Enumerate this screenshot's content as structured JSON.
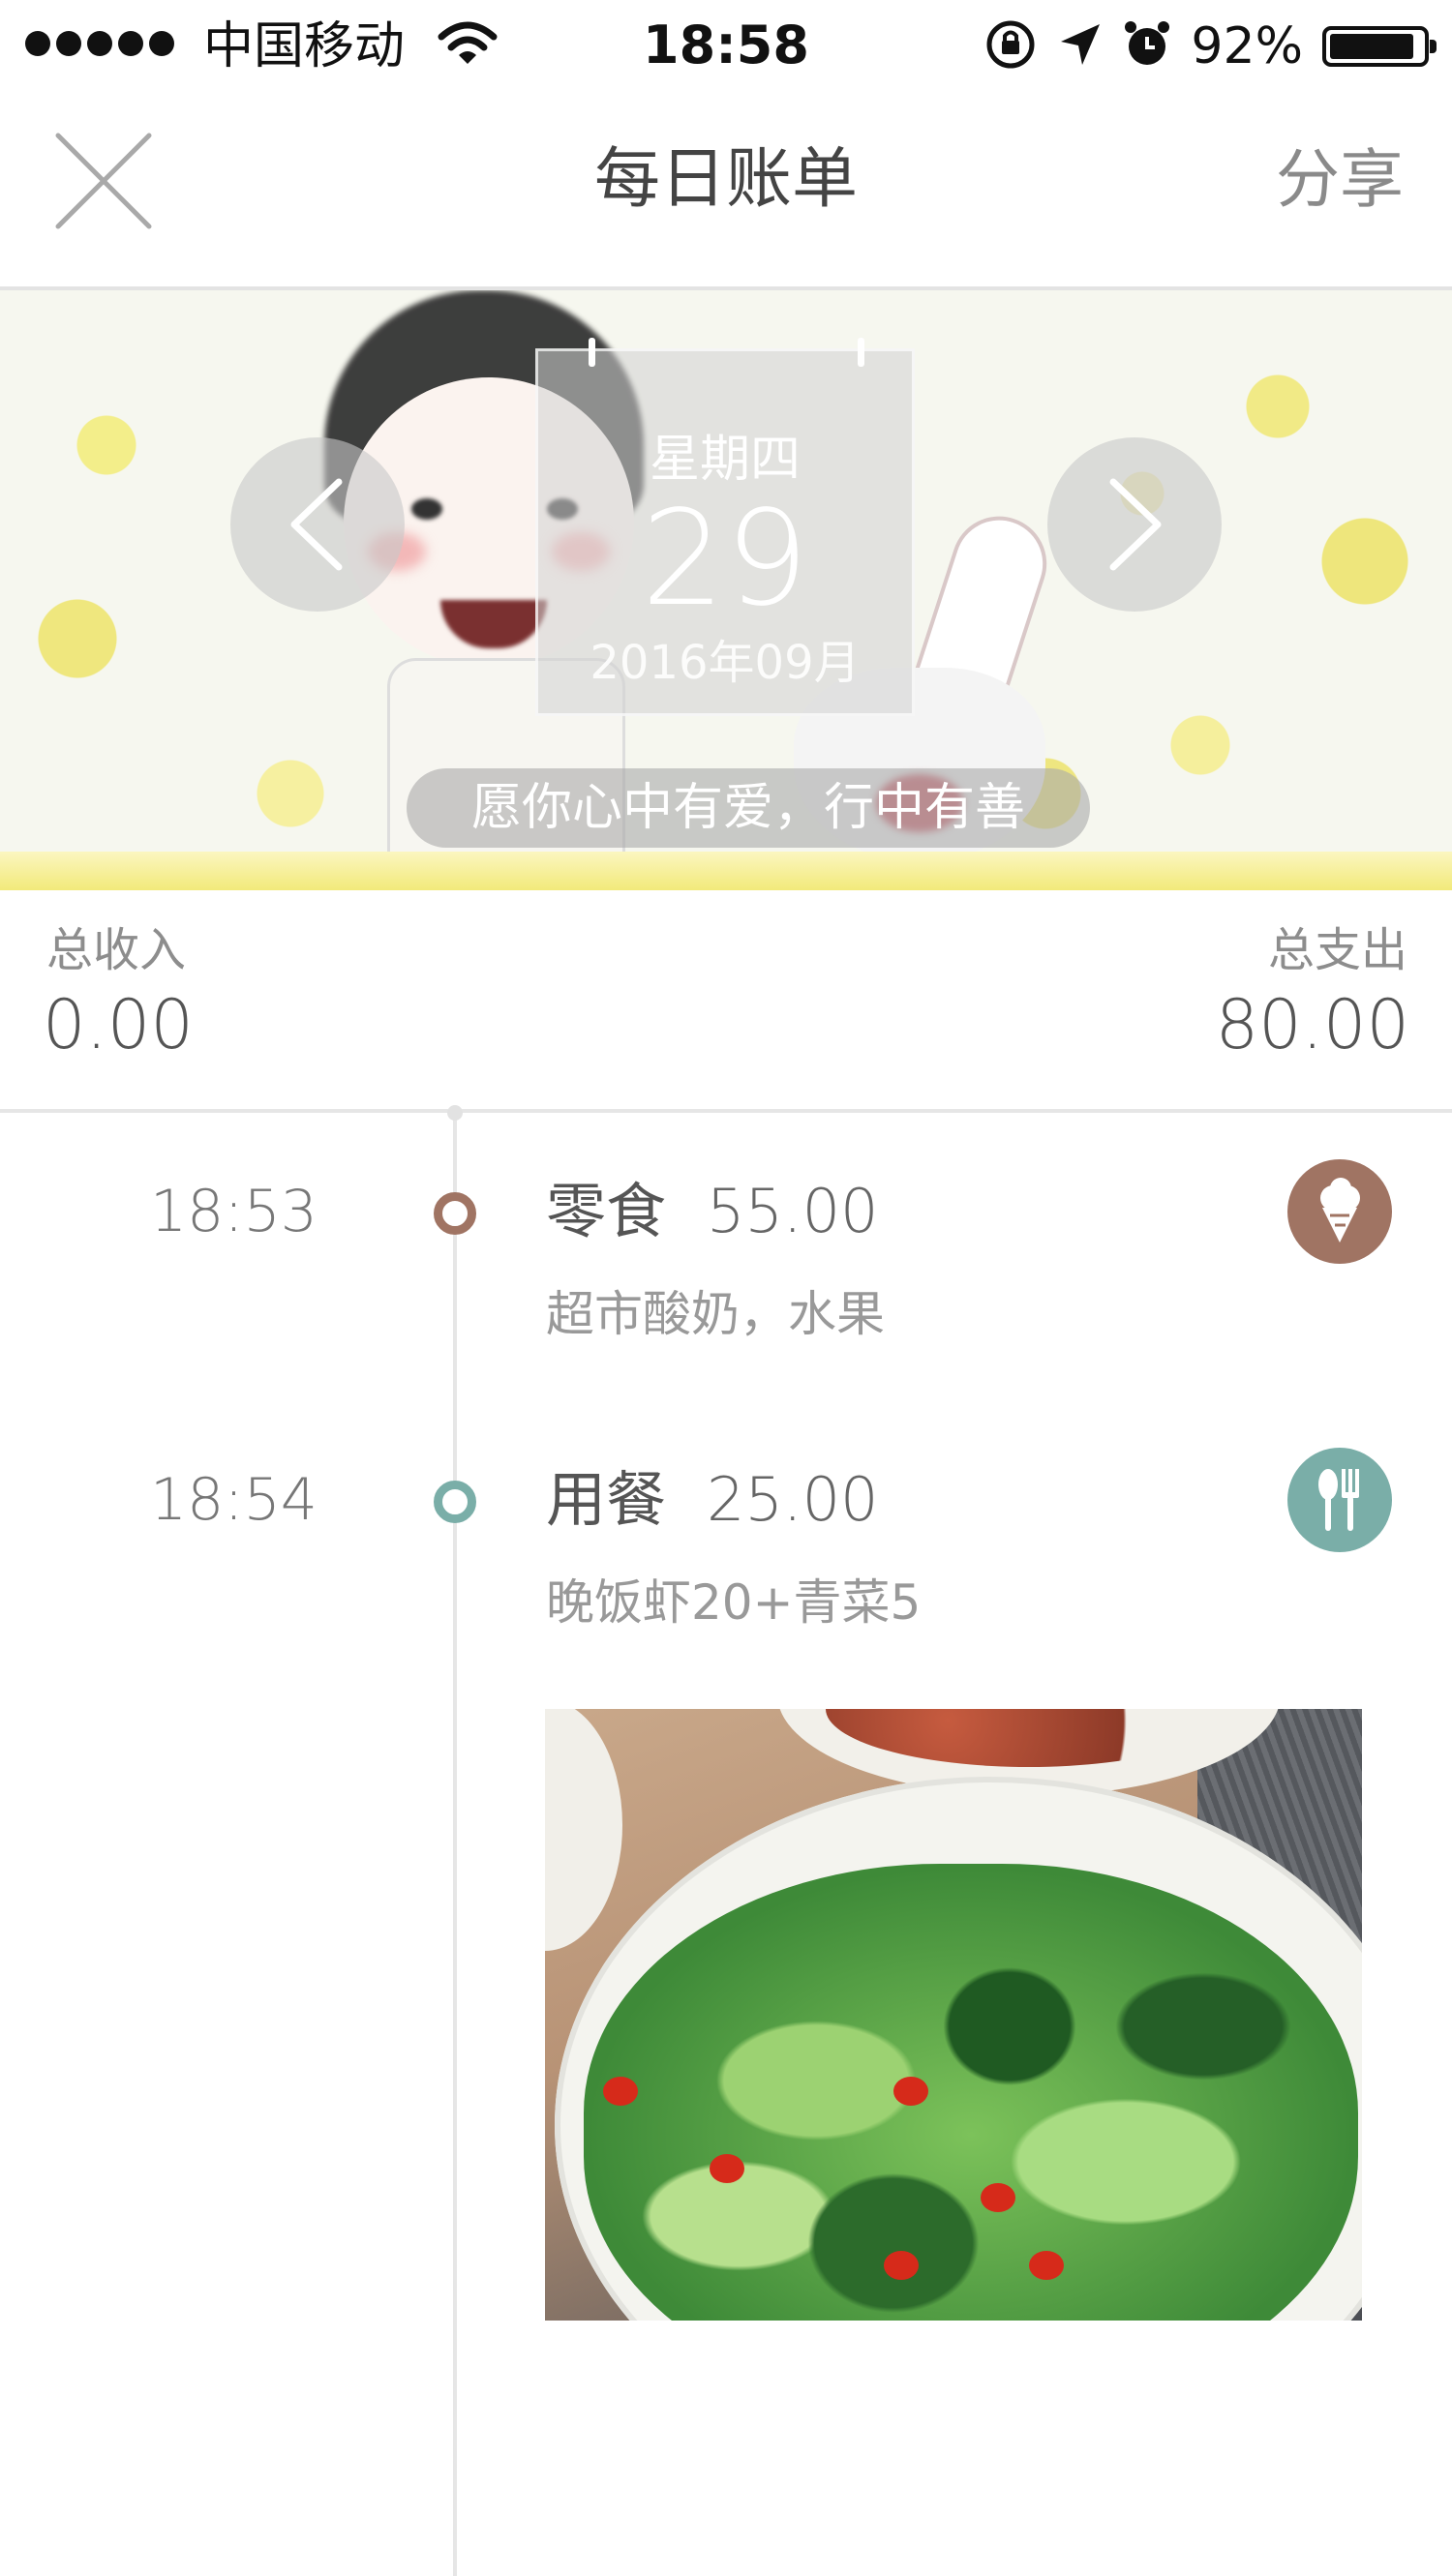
{
  "status_bar": {
    "carrier": "中国移动",
    "time": "18:58",
    "battery_percent": "92%",
    "battery_level": 0.92
  },
  "nav": {
    "title": "每日账单",
    "share_label": "分享"
  },
  "banner": {
    "weekday": "星期四",
    "day": "29",
    "month": "2016年09月",
    "quote": "愿你心中有爱，行中有善"
  },
  "totals": {
    "income_label": "总收入",
    "income_value": "0.00",
    "expense_label": "总支出",
    "expense_value": "80.00"
  },
  "entries": [
    {
      "time": "18:53",
      "category": "零食",
      "amount": "55.00",
      "note": "超市酸奶，水果",
      "color": "#a07463",
      "icon": "ice-cream-icon"
    },
    {
      "time": "18:54",
      "category": "用餐",
      "amount": "25.00",
      "note": "晚饭虾20+青菜5",
      "color": "#7aaea8",
      "icon": "utensils-icon"
    }
  ]
}
